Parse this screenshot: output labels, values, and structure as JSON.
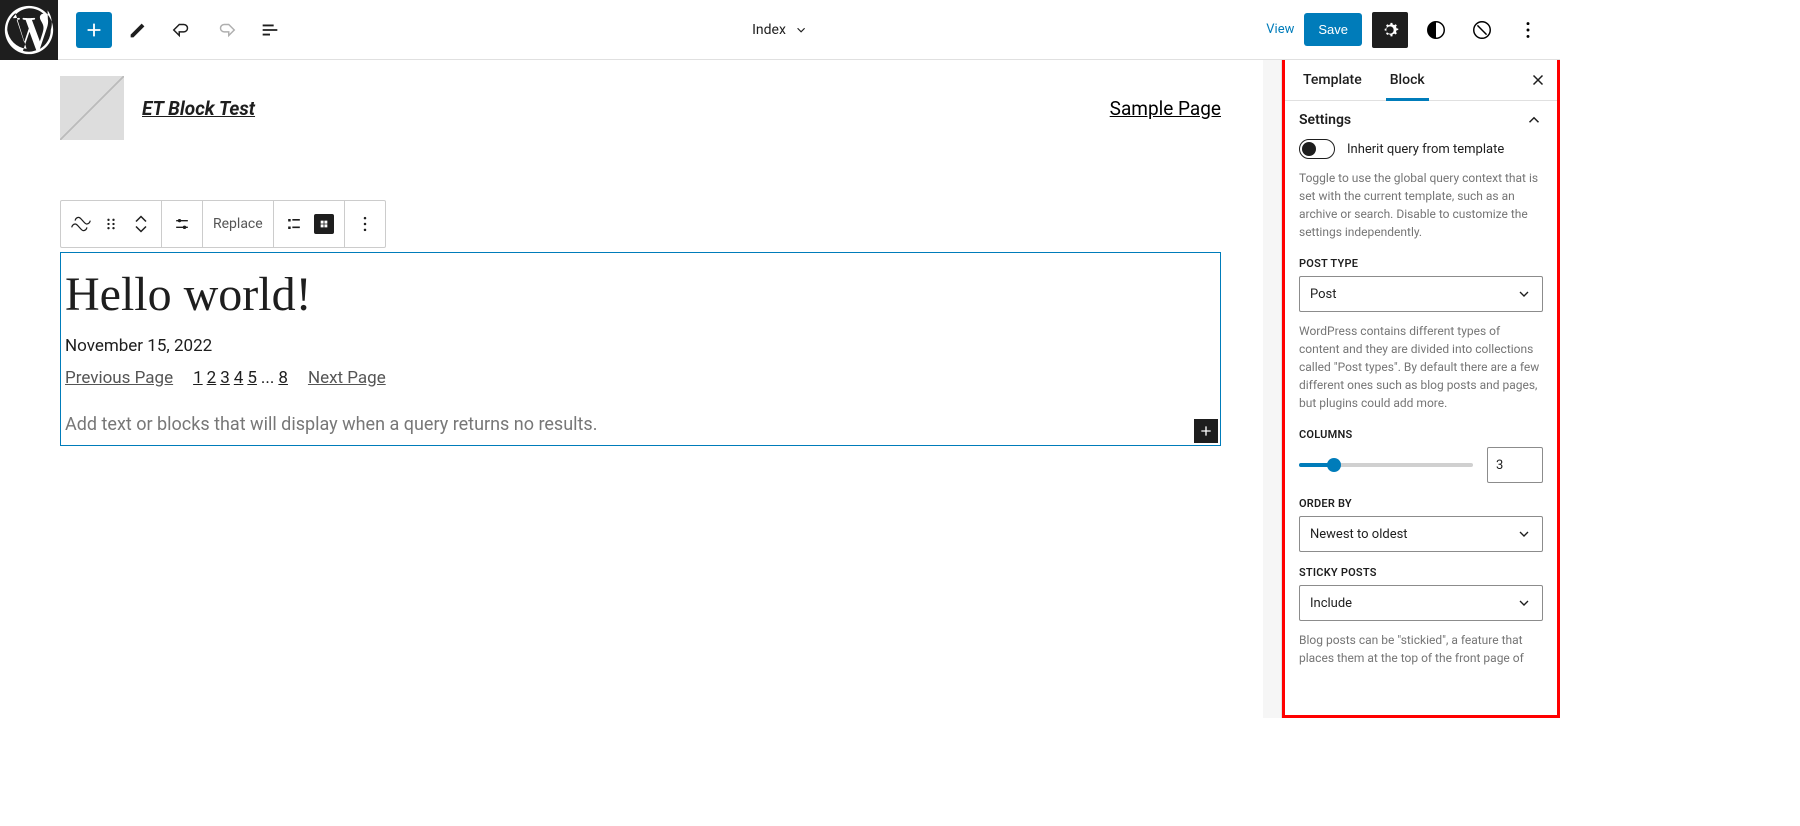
{
  "topbar": {
    "document_label": "Index",
    "view": "View",
    "save": "Save"
  },
  "site": {
    "title": "ET Block Test",
    "nav_item": "Sample Page"
  },
  "toolbar": {
    "replace": "Replace"
  },
  "post": {
    "title": "Hello world!",
    "date": "November 15, 2022"
  },
  "pagination": {
    "prev": "Previous Page",
    "pages": [
      "1",
      "2",
      "3",
      "4",
      "5"
    ],
    "dots": "...",
    "last": "8",
    "next": "Next Page"
  },
  "query_block": {
    "no_results_placeholder": "Add text or blocks that will display when a query returns no results."
  },
  "sidebar": {
    "tabs": {
      "template": "Template",
      "block": "Block"
    },
    "settings_label": "Settings",
    "inherit": {
      "label": "Inherit query from template",
      "desc": "Toggle to use the global query context that is set with the current template, such as an archive or search. Disable to customize the settings independently."
    },
    "post_type": {
      "label": "POST TYPE",
      "value": "Post",
      "desc": "WordPress contains different types of content and they are divided into collections called \"Post types\". By default there are a few different ones such as blog posts and pages, but plugins could add more."
    },
    "columns": {
      "label": "COLUMNS",
      "value": "3",
      "min": 1,
      "max": 12
    },
    "order_by": {
      "label": "ORDER BY",
      "value": "Newest to oldest"
    },
    "sticky_posts": {
      "label": "STICKY POSTS",
      "value": "Include",
      "desc": "Blog posts can be \"stickied\", a feature that places them at the top of the front page of"
    }
  }
}
